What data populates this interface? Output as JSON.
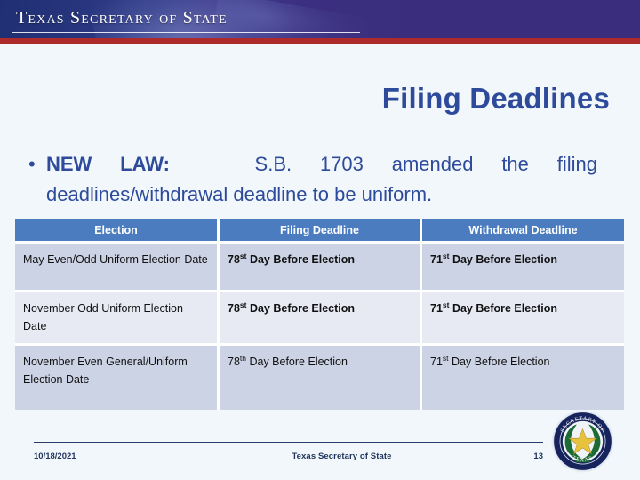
{
  "banner": {
    "org_title": "Texas Secretary of State"
  },
  "slide": {
    "title": "Filing Deadlines",
    "bullet": {
      "lead": "NEW LAW:",
      "line1_rest": "S.B. 1703 amended the filing",
      "line2": "deadlines/withdrawal deadline to be uniform."
    }
  },
  "table": {
    "headers": [
      "Election",
      "Filing Deadline",
      "Withdrawal Deadline"
    ],
    "rows": [
      {
        "election": "May Even/Odd Uniform Election Date",
        "filing_num": "78",
        "filing_sup": "st",
        "filing_rest": " Day Before Election",
        "withdrawal_num": "71",
        "withdrawal_sup": "st",
        "withdrawal_rest": " Day Before Election"
      },
      {
        "election": "November Odd Uniform Election Date",
        "filing_num": "78",
        "filing_sup": "st",
        "filing_rest": " Day Before Election",
        "withdrawal_num": "71",
        "withdrawal_sup": "st",
        "withdrawal_rest": " Day Before Election"
      },
      {
        "election": "November Even General/Uniform Election Date",
        "filing_num": "78",
        "filing_sup": "th",
        "filing_rest": " Day Before Election",
        "withdrawal_num": "71",
        "withdrawal_sup": "st",
        "withdrawal_rest": " Day Before Election"
      }
    ]
  },
  "footer": {
    "date": "10/18/2021",
    "center": "Texas Secretary of State",
    "page": "13"
  },
  "seal": {
    "outer_text_top": "SECRETARY OF",
    "outer_text_bottom": "STATE",
    "inner_text": "TEXAS"
  },
  "colors": {
    "banner_navy": "#3a2d7d",
    "banner_blue": "#1f2f72",
    "red_stripe": "#ad2b2b",
    "title_blue": "#2e4b9b",
    "table_header": "#4a7cbf",
    "row_shade": "#ccd3e4",
    "row_light": "#e7eaf3",
    "page_bg": "#f1f7fa",
    "seal_navy": "#16235c",
    "seal_star": "#e8c23d",
    "seal_wreath": "#1c6b35"
  }
}
